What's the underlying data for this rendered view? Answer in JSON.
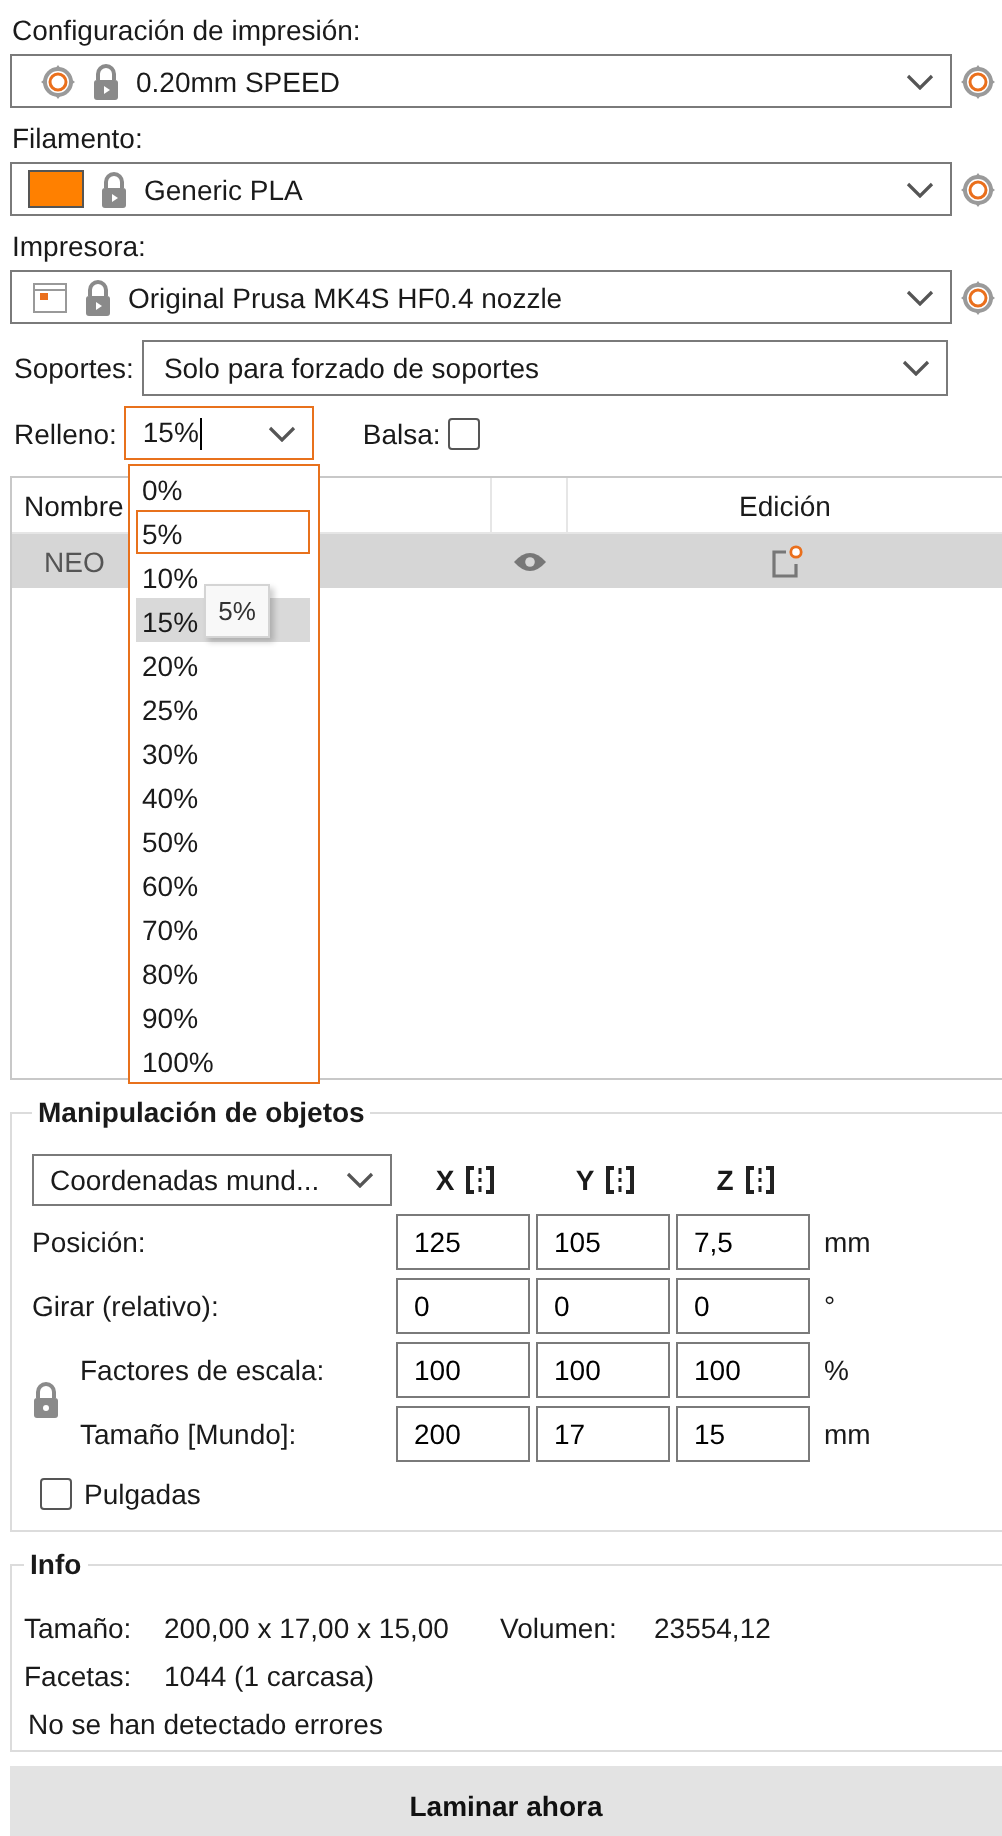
{
  "presets": [
    {
      "kind": "print",
      "label": "Configuración de impresión:",
      "value": "0.20mm SPEED"
    },
    {
      "kind": "filament",
      "label": "Filamento:",
      "value": "Generic PLA",
      "color": "#ff8000"
    },
    {
      "kind": "printer",
      "label": "Impresora:",
      "value": "Original Prusa MK4S HF0.4 nozzle"
    }
  ],
  "supports": {
    "label": "Soportes:",
    "value": "Solo para forzado de soportes"
  },
  "infill": {
    "label": "Relleno:",
    "value": "15%",
    "expanded": true
  },
  "brim": {
    "label": "Balsa:",
    "checked": false
  },
  "object_list": {
    "columns": [
      "Nombre",
      "Edición"
    ],
    "rows": [
      {
        "name": "NEO",
        "selected": true
      }
    ]
  },
  "infill_options": [
    {
      "label": "0%",
      "selected": false,
      "hovered": false
    },
    {
      "label": "5%",
      "selected": false,
      "hovered": true
    },
    {
      "label": "10%",
      "selected": false,
      "hovered": false
    },
    {
      "label": "15%",
      "selected": true,
      "hovered": false
    },
    {
      "label": "20%",
      "selected": false,
      "hovered": false
    },
    {
      "label": "25%",
      "selected": false,
      "hovered": false
    },
    {
      "label": "30%",
      "selected": false,
      "hovered": false
    },
    {
      "label": "40%",
      "selected": false,
      "hovered": false
    },
    {
      "label": "50%",
      "selected": false,
      "hovered": false
    },
    {
      "label": "60%",
      "selected": false,
      "hovered": false
    },
    {
      "label": "70%",
      "selected": false,
      "hovered": false
    },
    {
      "label": "80%",
      "selected": false,
      "hovered": false
    },
    {
      "label": "90%",
      "selected": false,
      "hovered": false
    },
    {
      "label": "100%",
      "selected": false,
      "hovered": false
    }
  ],
  "tooltip": "5%",
  "manipulation": {
    "title": "Manipulación de objetos",
    "coordinates": "Coordenadas mund...",
    "axes": [
      "X",
      "Y",
      "Z"
    ],
    "rows": [
      {
        "label": "Posición:",
        "values": [
          "125",
          "105",
          "7,5"
        ],
        "unit": "mm",
        "linked": false
      },
      {
        "label": "Girar (relativo):",
        "values": [
          "0",
          "0",
          "0"
        ],
        "unit": "°",
        "linked": false
      },
      {
        "label": "Factores de escala:",
        "values": [
          "100",
          "100",
          "100"
        ],
        "unit": "%",
        "linked": true
      },
      {
        "label": "Tamaño [Mundo]:",
        "values": [
          "200",
          "17",
          "15"
        ],
        "unit": "mm",
        "linked": true
      }
    ],
    "inches": {
      "label": "Pulgadas",
      "checked": false
    }
  },
  "info": {
    "title": "Info",
    "rows": [
      {
        "cells": [
          "Tamaño:",
          "200,00 x 17,00 x 15,00",
          "Volumen:",
          "23554,12"
        ]
      },
      {
        "cells": [
          "Facetas:",
          "1044 (1 carcasa)"
        ]
      }
    ],
    "message": "No se han detectado errores"
  },
  "slice_button": "Laminar ahora"
}
